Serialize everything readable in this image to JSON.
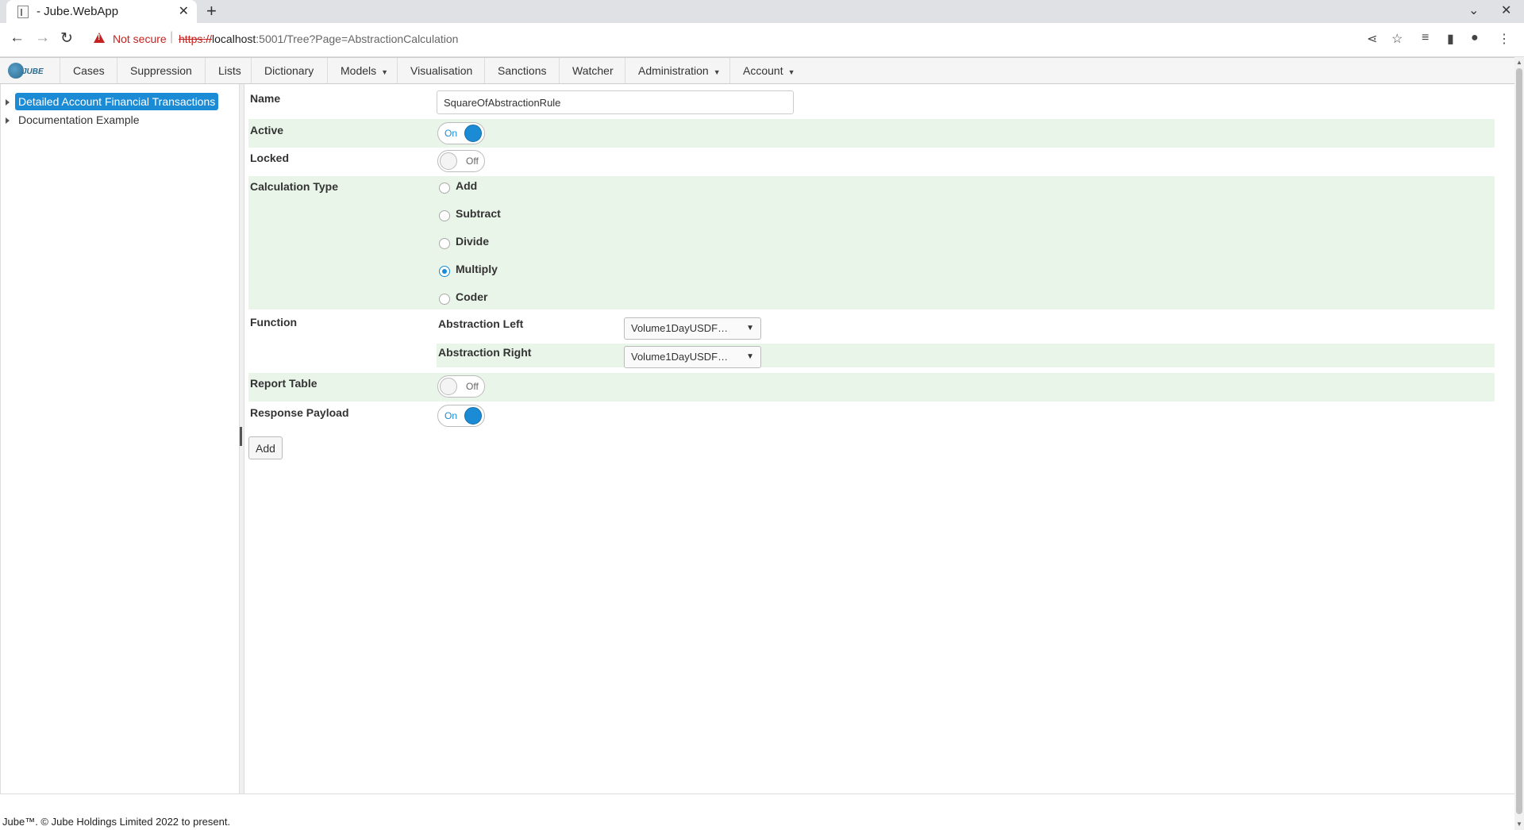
{
  "browser": {
    "tab_title": "- Jube.WebApp",
    "not_secure": "Not secure",
    "url_scheme": "https://",
    "url_host": "localhost",
    "url_rest": ":5001/Tree?Page=AbstractionCalculation"
  },
  "app": {
    "logo_text": "JUBE",
    "menu": [
      {
        "label": "Cases"
      },
      {
        "label": "Suppression"
      },
      {
        "label": "Lists"
      },
      {
        "label": "Dictionary"
      },
      {
        "label": "Models"
      },
      {
        "label": "Visualisation"
      },
      {
        "label": "Sanctions"
      },
      {
        "label": "Watcher"
      },
      {
        "label": "Administration"
      },
      {
        "label": "Account"
      }
    ],
    "tree": [
      {
        "label": "Detailed Account Financial Transactions",
        "selected": true
      },
      {
        "label": "Documentation Example",
        "selected": false
      }
    ],
    "form": {
      "name_label": "Name",
      "name_value": "SquareOfAbstractionRule",
      "active_label": "Active",
      "active_state": "On",
      "locked_label": "Locked",
      "locked_state": "Off",
      "calc_type_label": "Calculation Type",
      "calc_options": [
        "Add",
        "Subtract",
        "Divide",
        "Multiply",
        "Coder"
      ],
      "calc_selected": "Multiply",
      "function_label": "Function",
      "abstraction_left_label": "Abstraction Left",
      "abstraction_left_value": "Volume1DayUSDF…",
      "abstraction_right_label": "Abstraction Right",
      "abstraction_right_value": "Volume1DayUSDF…",
      "report_table_label": "Report Table",
      "report_table_state": "Off",
      "response_payload_label": "Response Payload",
      "response_payload_state": "On",
      "add_button": "Add"
    },
    "footer": "Jube™. © Jube Holdings Limited 2022 to present."
  },
  "colors": {
    "accent": "#1a8bd4",
    "row_alt": "#eaf5ea",
    "warning": "#c5221f"
  }
}
